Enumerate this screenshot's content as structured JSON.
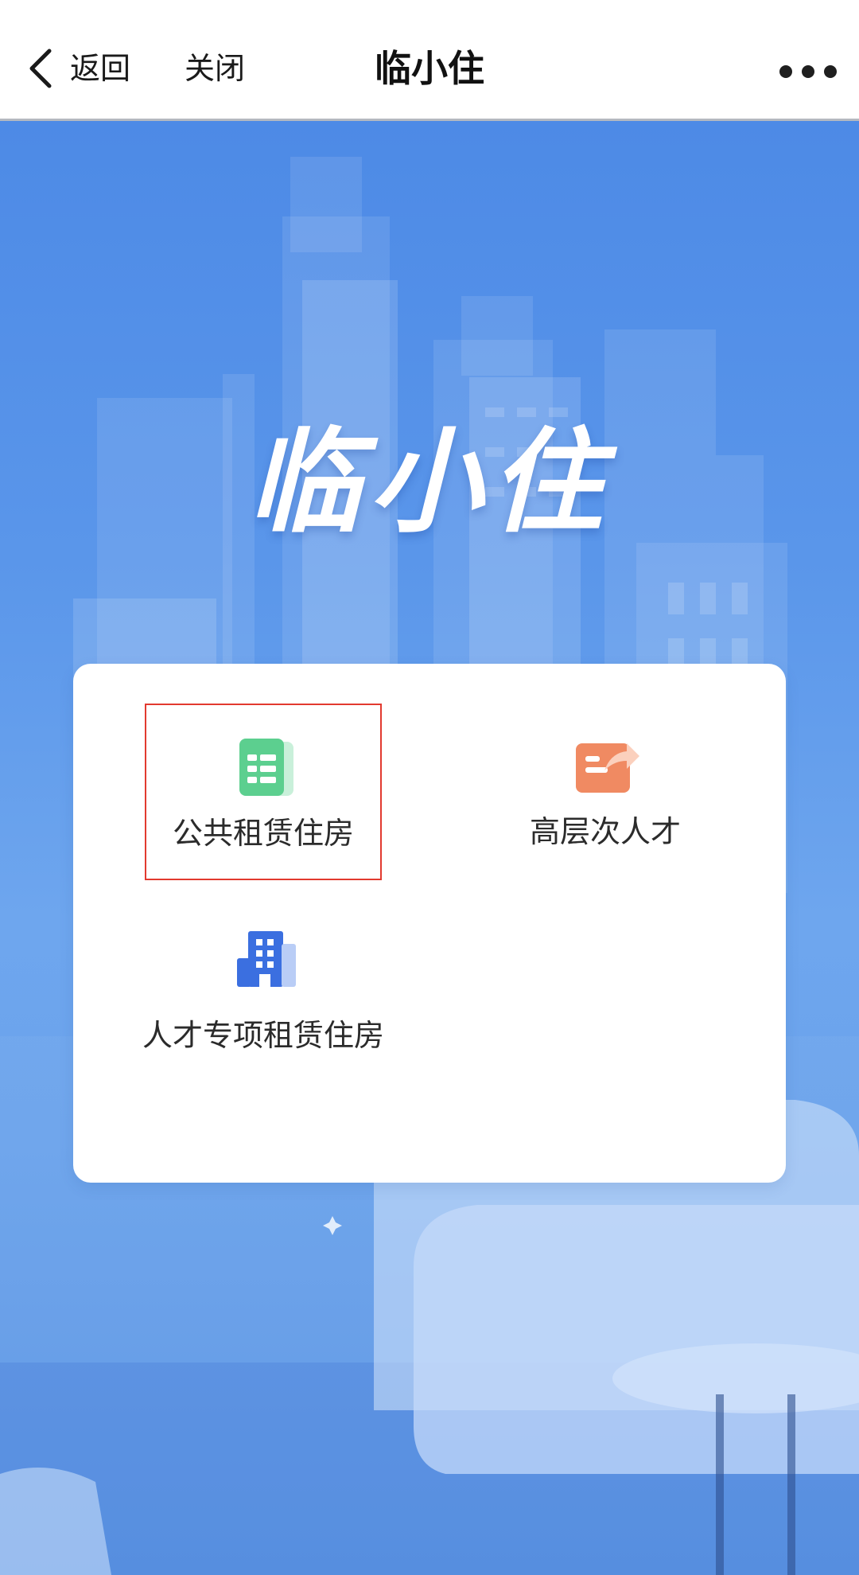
{
  "navbar": {
    "back_label": "返回",
    "close_label": "关闭",
    "title": "临小住",
    "more_icon": "more-dots-icon"
  },
  "hero": {
    "logo_text": "临小住"
  },
  "services": [
    {
      "label": "公共租赁住房",
      "icon": "building-doc-icon",
      "icon_color": "#5ccf8f",
      "highlighted": true,
      "highlight_color": "#e23a2f"
    },
    {
      "label": "高层次人才",
      "icon": "share-card-icon",
      "icon_color": "#f08a62",
      "highlighted": false
    },
    {
      "label": "人才专项租赁住房",
      "icon": "office-building-icon",
      "icon_color": "#3b6fe0",
      "highlighted": false
    }
  ],
  "colors": {
    "hero_top": "#4d8ae6",
    "hero_bottom": "#5a95e4",
    "card_bg": "#ffffff"
  }
}
